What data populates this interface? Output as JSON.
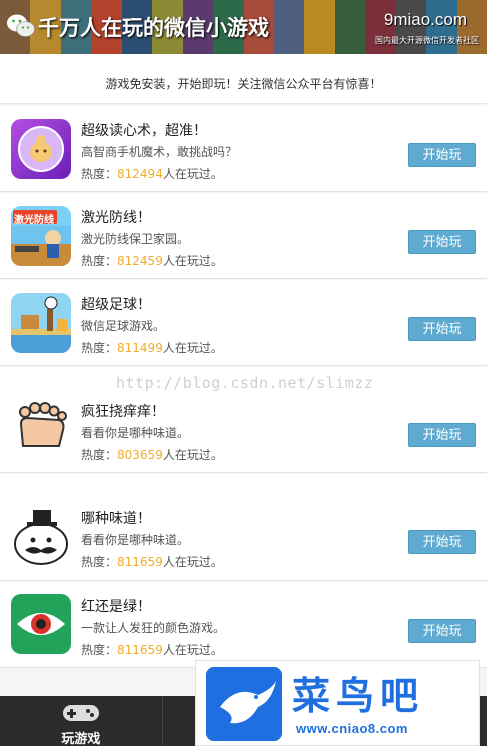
{
  "banner": {
    "title": "千万人在玩的微信小游戏",
    "site_name": "9miao.com",
    "site_sub": "国内最大开源微信开发者社区",
    "stripe_colors": [
      "#7b5a3a",
      "#b6892e",
      "#3d6f7a",
      "#b4412c",
      "#2c4d72",
      "#8d8a36",
      "#5b3b6e",
      "#2d6a4a",
      "#a84b3b",
      "#4f5f80",
      "#b98a1f",
      "#385e3d",
      "#7a2f3b",
      "#4a4a4a",
      "#2f6d8e",
      "#9b6b2e"
    ]
  },
  "notice": "游戏免安装，开始即玩！关注微信公众平台有惊喜！",
  "games": [
    {
      "title": "超级读心术，超准！",
      "desc": "高智商手机魔术，敢挑战吗？",
      "heat_label": "热度：",
      "heat_value": "812494",
      "heat_suffix": "人在玩过。",
      "button": "开始玩",
      "icon": "crystal-ball-icon"
    },
    {
      "title": "激光防线！",
      "desc": "激光防线保卫家园。",
      "heat_label": "热度：",
      "heat_value": "812459",
      "heat_suffix": "人在玩过。",
      "button": "开始玩",
      "icon": "laser-defense-icon",
      "icon_text": "激光防线"
    },
    {
      "title": "超级足球！",
      "desc": "微信足球游戏。",
      "heat_label": "热度：",
      "heat_value": "811499",
      "heat_suffix": "人在玩过。",
      "button": "开始玩",
      "icon": "football-icon"
    },
    {
      "title": "疯狂挠痒痒！",
      "desc": "看看你是哪种味道。",
      "heat_label": "热度：",
      "heat_value": "803659",
      "heat_suffix": "人在玩过。",
      "button": "开始玩",
      "icon": "foot-icon"
    },
    {
      "title": "哪种味道！",
      "desc": "看看你是哪种味道。",
      "heat_label": "热度：",
      "heat_value": "811659",
      "heat_suffix": "人在玩过。",
      "button": "开始玩",
      "icon": "mustache-face-icon"
    },
    {
      "title": "红还是绿！",
      "desc": "一款让人发狂的颜色游戏。",
      "heat_label": "热度：",
      "heat_value": "811659",
      "heat_suffix": "人在玩过。",
      "button": "开始玩",
      "icon": "eye-icon"
    }
  ],
  "watermark": "http://blog.csdn.net/slimzz",
  "tabbar": {
    "tabs": [
      {
        "label": "玩游戏",
        "icon": "gamepad-icon"
      },
      {
        "label": "",
        "icon": ""
      },
      {
        "label": "",
        "icon": ""
      }
    ]
  },
  "promo": {
    "brand": "菜鸟吧",
    "url": "www.cniao8.com",
    "logo": "bird-logo-icon"
  },
  "colors": {
    "button": "#5eaad0",
    "heat_number": "#f0ad2d",
    "tabbar": "#2b2b2b",
    "brand": "#1f6fe0"
  }
}
